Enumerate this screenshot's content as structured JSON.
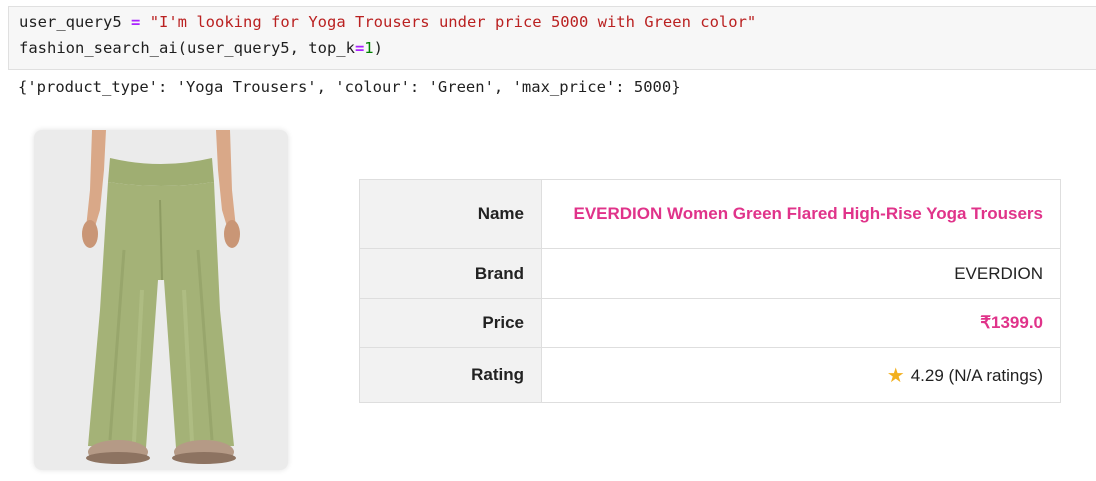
{
  "code": {
    "line1": {
      "var": "user_query5",
      "op": "=",
      "str": "\"I'm looking for Yoga Trousers under price 5000 with Green color\""
    },
    "line2": {
      "func": "fashion_search_ai(user_query5, top_k",
      "op": "=",
      "num": "1",
      "close": ")"
    }
  },
  "output": {
    "stdout": "{'product_type': 'Yoga Trousers', 'colour': 'Green', 'max_price': 5000}"
  },
  "product": {
    "image_icon": "green-flared-trousers-photo",
    "name_label": "Name",
    "name_value": "EVERDION Women Green Flared High-Rise Yoga Trousers",
    "brand_label": "Brand",
    "brand_value": "EVERDION",
    "price_label": "Price",
    "price_value": "₹1399.0",
    "rating_label": "Rating",
    "rating_value": "4.29 (N/A ratings)",
    "rating_icon": "star-icon",
    "accent_color": "#e0338a"
  }
}
